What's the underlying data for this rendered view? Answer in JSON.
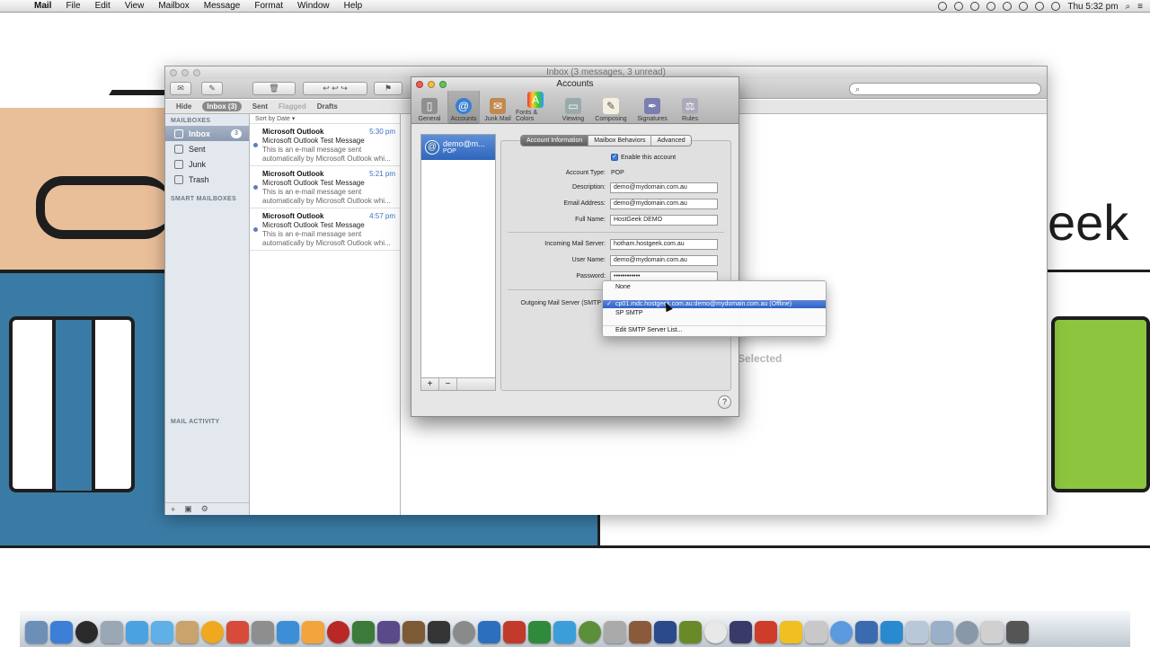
{
  "menubar": {
    "items": [
      "Mail",
      "File",
      "Edit",
      "View",
      "Mailbox",
      "Message",
      "Format",
      "Window",
      "Help"
    ],
    "clock": "Thu 5:32 pm"
  },
  "wallpaper": {
    "word": "eek",
    "dialog_hint": "Selected"
  },
  "mail_window": {
    "title": "Inbox (3 messages, 3 unread)",
    "favorites": {
      "hide": "Hide",
      "inbox": "Inbox (3)",
      "sent": "Sent",
      "flagged": "Flagged",
      "drafts": "Drafts"
    },
    "sidebar": {
      "mailboxes_header": "MAILBOXES",
      "items": [
        {
          "label": "Inbox",
          "badge": "3"
        },
        {
          "label": "Sent"
        },
        {
          "label": "Junk"
        },
        {
          "label": "Trash"
        }
      ],
      "smart_header": "SMART MAILBOXES",
      "activity_header": "MAIL ACTIVITY"
    },
    "sort_label": "Sort by Date ▾",
    "messages": [
      {
        "from": "Microsoft Outlook",
        "time": "5:30 pm",
        "subject": "Microsoft Outlook Test Message",
        "preview1": "This is an e-mail message sent",
        "preview2": "automatically by Microsoft Outlook whi..."
      },
      {
        "from": "Microsoft Outlook",
        "time": "5:21 pm",
        "subject": "Microsoft Outlook Test Message",
        "preview1": "This is an e-mail message sent",
        "preview2": "automatically by Microsoft Outlook whi..."
      },
      {
        "from": "Microsoft Outlook",
        "time": "4:57 pm",
        "subject": "Microsoft Outlook Test Message",
        "preview1": "This is an e-mail message sent",
        "preview2": "automatically by Microsoft Outlook whi..."
      }
    ]
  },
  "prefs": {
    "title": "Accounts",
    "toolbar": [
      "General",
      "Accounts",
      "Junk Mail",
      "Fonts & Colors",
      "Viewing",
      "Composing",
      "Signatures",
      "Rules"
    ],
    "account": {
      "name": "demo@m...",
      "type": "POP"
    },
    "tabs": [
      "Account Information",
      "Mailbox Behaviors",
      "Advanced"
    ],
    "enable_label": "Enable this account",
    "fields": {
      "account_type_label": "Account Type:",
      "account_type": "POP",
      "description_label": "Description:",
      "description": "demo@mydomain.com.au",
      "email_label": "Email Address:",
      "email": "demo@mydomain.com.au",
      "fullname_label": "Full Name:",
      "fullname": "HostGeek DEMO",
      "incoming_label": "Incoming Mail Server:",
      "incoming": "hotham.hostgeek.com.au",
      "username_label": "User Name:",
      "username": "demo@mydomain.com.au",
      "password_label": "Password:",
      "password": "••••••••••••",
      "outgoing_label": "Outgoing Mail Server (SMTP"
    },
    "list_buttons": {
      "add": "+",
      "remove": "−"
    },
    "help": "?"
  },
  "smtp_menu": {
    "options": [
      "None",
      "cp01.mdc.hostgeek.com.au:demo@mydomain.com.au (Offline)",
      "SP SMTP",
      "Edit SMTP Server List..."
    ],
    "checkmark": "✓"
  },
  "dock_colors": [
    "#6c8fb8",
    "#3d7fd6",
    "#2a2a2a",
    "#9aa7b5",
    "#4aa2e0",
    "#5fb0e6",
    "#c9a36b",
    "#f0a81e",
    "#d84a3a",
    "#8e8e8e",
    "#3a8fd6",
    "#f2a53c",
    "#b92727",
    "#3c7a3a",
    "#5a4a8a",
    "#7d5a36",
    "#353535",
    "#8a8a8a",
    "#2c6fbf",
    "#c23a2a",
    "#2f8a3c",
    "#3b9dd9",
    "#5c8f3a",
    "#aaaaaa",
    "#8a5a3a",
    "#2a4a8a",
    "#6a8a2a",
    "#e8e8e8",
    "#3a3a6a",
    "#d03c2a",
    "#f0c020",
    "#c8c8c8",
    "#5a9ae0",
    "#3a6ab0",
    "#2a8ad0",
    "#b8c8d8",
    "#9ab0c8",
    "#8898a8",
    "#d0d0d0",
    "#555555"
  ]
}
